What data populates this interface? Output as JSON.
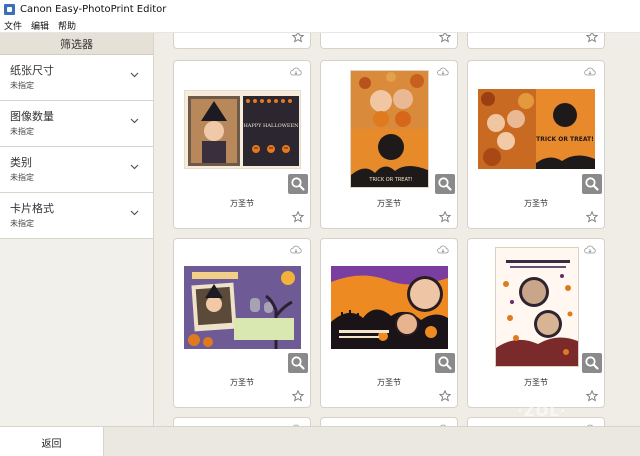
{
  "window": {
    "title": "Canon Easy-PhotoPrint Editor"
  },
  "menu": {
    "file": "文件",
    "edit": "编辑",
    "help": "帮助"
  },
  "sidebar": {
    "header": "筛选器",
    "filters": [
      {
        "label": "纸张尺寸",
        "value": "未指定"
      },
      {
        "label": "图像数量",
        "value": "未指定"
      },
      {
        "label": "类别",
        "value": "未指定"
      },
      {
        "label": "卡片格式",
        "value": "未指定"
      }
    ]
  },
  "footer": {
    "back_label": "返回"
  },
  "templates": {
    "row1": [
      "万圣节",
      "万圣节",
      "万圣节"
    ],
    "row2": [
      "万圣节",
      "万圣节",
      "万圣节"
    ]
  },
  "thumbnail_text": {
    "happy_halloween": "HAPPY HALLOWEEN",
    "trick_or_treat": "TRICK OR TREAT!",
    "trick_or_treat_stacked": "TRICK OR TREAT!"
  },
  "colors": {
    "accent_orange": "#e07a1f",
    "card_border": "#d6d2c8",
    "sidebar_bg": "#f2f0ea"
  },
  "watermark": "·ZOL·"
}
